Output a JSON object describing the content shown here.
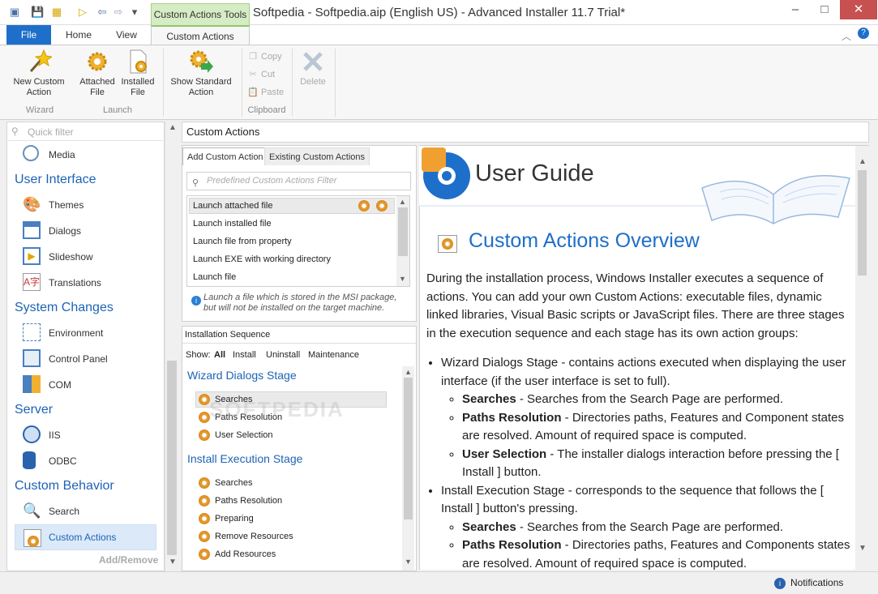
{
  "window": {
    "title": "Softpedia - Softpedia.aip (English US) - Advanced Installer 11.7 Trial*",
    "context_tab_group": "Custom Actions Tools",
    "minimize": "–",
    "maximize": "□",
    "close": "✕"
  },
  "ribbon_tabs": [
    "File",
    "Home",
    "View",
    "Custom Actions"
  ],
  "ribbon": {
    "new_custom_action": "New Custom Action",
    "attached_file": "Attached File",
    "installed_file": "Installed File",
    "show_standard_action": "Show Standard Action",
    "copy": "Copy",
    "cut": "Cut",
    "paste": "Paste",
    "delete": "Delete",
    "groups": {
      "wizard": "Wizard",
      "launch": "Launch",
      "clipboard": "Clipboard"
    }
  },
  "sidebar": {
    "filter_placeholder": "Quick filter",
    "items": {
      "media": "Media",
      "ui_head": "User Interface",
      "themes": "Themes",
      "dialogs": "Dialogs",
      "slideshow": "Slideshow",
      "translations": "Translations",
      "sys_head": "System Changes",
      "environment": "Environment",
      "control_panel": "Control Panel",
      "com": "COM",
      "server_head": "Server",
      "iis": "IIS",
      "odbc": "ODBC",
      "behavior_head": "Custom Behavior",
      "search": "Search",
      "custom_actions": "Custom Actions"
    },
    "add_remove": "Add/Remove"
  },
  "main": {
    "header": "Custom Actions",
    "tabs": [
      "Add Custom Action",
      "Existing Custom Actions"
    ],
    "filter_placeholder": "Predefined Custom Actions Filter",
    "launch_items": [
      "Launch attached file",
      "Launch installed file",
      "Launch file from property",
      "Launch EXE with working directory",
      "Launch file"
    ],
    "hint": "Launch a file which is stored in the MSI package, but will not be installed on the target machine.",
    "sequence": {
      "title": "Installation Sequence",
      "show_label": "Show:",
      "filters": [
        "All",
        "Install",
        "Uninstall",
        "Maintenance"
      ],
      "stage1": "Wizard Dialogs Stage",
      "stage1_items": [
        "Searches",
        "Paths Resolution",
        "User Selection"
      ],
      "stage2": "Install Execution Stage",
      "stage2_items": [
        "Searches",
        "Paths Resolution",
        "Preparing",
        "Remove Resources",
        "Add Resources"
      ]
    }
  },
  "guide": {
    "title": "User Guide",
    "heading": "Custom Actions Overview",
    "intro": "During the installation process, Windows Installer executes a sequence of actions. You can add your own Custom Actions: executable files, dynamic linked libraries, Visual Basic scripts or JavaScript files. There are three stages in the execution sequence and each stage has its own action groups:",
    "b1": "Wizard Dialogs Stage - contains actions executed when displaying the user interface (if the user interface is set to full).",
    "b1_1_t": "Searches",
    "b1_1": " - Searches from the Search Page are performed.",
    "b1_2_t": "Paths Resolution",
    "b1_2": " - Directories paths, Features and Component states are resolved. Amount of required space is computed.",
    "b1_3_t": "User Selection",
    "b1_3": " - The installer dialogs interaction before pressing the [ Install ] button.",
    "b2": "Install Execution Stage - corresponds to the sequence that follows the [ Install ] button's pressing.",
    "b2_1_t": "Searches",
    "b2_1": " - Searches from the Search Page are performed.",
    "b2_2_t": "Paths Resolution",
    "b2_2": " - Directories paths, Features and Components states are resolved. Amount of required space is computed."
  },
  "status": {
    "notifications": "Notifications"
  },
  "watermark": "SOFTPEDIA"
}
